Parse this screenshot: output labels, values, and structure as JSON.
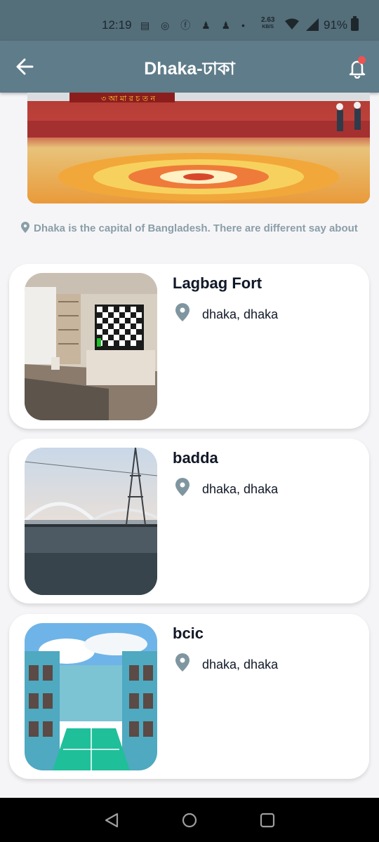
{
  "status_bar": {
    "time": "12:19",
    "speed_value": "2.63",
    "speed_unit": "KB/S",
    "battery": "91%"
  },
  "app_bar": {
    "title": "Dhaka-ঢাকা",
    "back_icon": "arrow-left-icon",
    "notification_icon": "bell-icon"
  },
  "hero": {
    "banner_text": "৩ আ মা র চ ত ন"
  },
  "description": "Dhaka is the capital of Bangladesh. There are different say about",
  "places": [
    {
      "name": "Lagbag Fort",
      "location": "dhaka, dhaka",
      "image": "room-with-tv"
    },
    {
      "name": "badda",
      "location": "dhaka, dhaka",
      "image": "bridge-over-river"
    },
    {
      "name": "bcic",
      "location": "dhaka, dhaka",
      "image": "building-courtyard"
    }
  ],
  "colors": {
    "app_bar": "#5f7c8a",
    "status_bar": "#546e7a",
    "accent_dot": "#ef5350",
    "muted_text": "#8a9ea8"
  }
}
